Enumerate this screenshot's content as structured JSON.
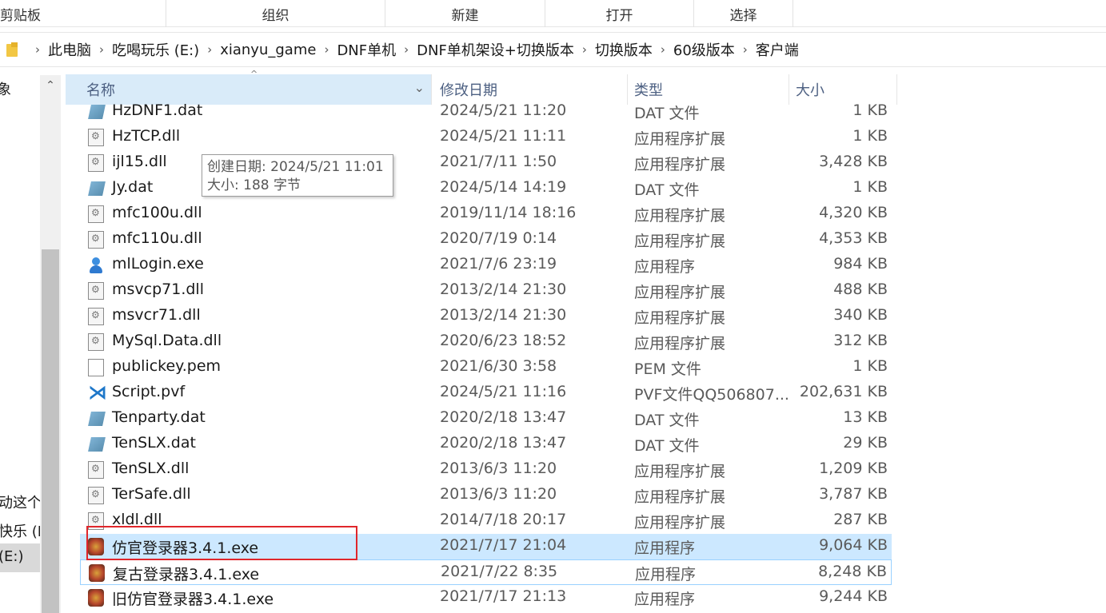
{
  "ribbon": {
    "groups": [
      "剪贴板",
      "组织",
      "新建",
      "打开",
      "选择"
    ]
  },
  "address_bar": {
    "crumbs": [
      "此电脑",
      "吃喝玩乐 (E:)",
      "xianyu_game",
      "DNF单机",
      "DNF单机架设+切换版本",
      "切换版本",
      "60级版本",
      "客户端"
    ],
    "separator": "›"
  },
  "nav_pane": {
    "items": [
      "象",
      "动这个",
      "快乐 (D",
      "(E:)"
    ],
    "scroll_up": "⌃"
  },
  "columns": {
    "name": "名称",
    "date": "修改日期",
    "type": "类型",
    "size": "大小",
    "sort_indicator": "^",
    "dropdown": "⌄"
  },
  "files": [
    {
      "name": "HzDNF1.dat",
      "date": "2024/5/21 11:20",
      "type": "DAT 文件",
      "size": "1 KB",
      "icon": "dat-file-icon"
    },
    {
      "name": "HzTCP.dll",
      "date": "2024/5/21 11:11",
      "type": "应用程序扩展",
      "size": "1 KB",
      "icon": "dll-file-icon"
    },
    {
      "name": "ijl15.dll",
      "date": "2021/7/11 1:50",
      "type": "应用程序扩展",
      "size": "3,428 KB",
      "icon": "dll-file-icon"
    },
    {
      "name": "Jy.dat",
      "date": "2024/5/14 14:19",
      "type": "DAT 文件",
      "size": "1 KB",
      "icon": "dat-file-icon"
    },
    {
      "name": "mfc100u.dll",
      "date": "2019/11/14 18:16",
      "type": "应用程序扩展",
      "size": "4,320 KB",
      "icon": "dll-file-icon"
    },
    {
      "name": "mfc110u.dll",
      "date": "2020/7/19 0:14",
      "type": "应用程序扩展",
      "size": "4,353 KB",
      "icon": "dll-file-icon"
    },
    {
      "name": "mlLogin.exe",
      "date": "2021/7/6 23:19",
      "type": "应用程序",
      "size": "984 KB",
      "icon": "user-exe-icon"
    },
    {
      "name": "msvcp71.dll",
      "date": "2013/2/14 21:30",
      "type": "应用程序扩展",
      "size": "488 KB",
      "icon": "dll-file-icon"
    },
    {
      "name": "msvcr71.dll",
      "date": "2013/2/14 21:30",
      "type": "应用程序扩展",
      "size": "340 KB",
      "icon": "dll-file-icon"
    },
    {
      "name": "MySql.Data.dll",
      "date": "2020/6/23 18:52",
      "type": "应用程序扩展",
      "size": "312 KB",
      "icon": "dll-file-icon"
    },
    {
      "name": "publickey.pem",
      "date": "2021/6/30 3:58",
      "type": "PEM 文件",
      "size": "1 KB",
      "icon": "pem-file-icon"
    },
    {
      "name": "Script.pvf",
      "date": "2024/5/21 11:16",
      "type": "PVF文件QQ506807...",
      "size": "202,631 KB",
      "icon": "vscode-file-icon"
    },
    {
      "name": "Tenparty.dat",
      "date": "2020/2/18 13:47",
      "type": "DAT 文件",
      "size": "13 KB",
      "icon": "dat-file-icon"
    },
    {
      "name": "TenSLX.dat",
      "date": "2020/2/18 13:47",
      "type": "DAT 文件",
      "size": "29 KB",
      "icon": "dat-file-icon"
    },
    {
      "name": "TenSLX.dll",
      "date": "2013/6/3 11:20",
      "type": "应用程序扩展",
      "size": "1,209 KB",
      "icon": "dll-file-icon"
    },
    {
      "name": "TerSafe.dll",
      "date": "2013/6/3 11:20",
      "type": "应用程序扩展",
      "size": "3,787 KB",
      "icon": "dll-file-icon"
    },
    {
      "name": "xldl.dll",
      "date": "2014/7/18 20:17",
      "type": "应用程序扩展",
      "size": "287 KB",
      "icon": "dll-file-icon"
    },
    {
      "name": "仿官登录器3.4.1.exe",
      "date": "2021/7/17 21:04",
      "type": "应用程序",
      "size": "9,064 KB",
      "icon": "game-exe-icon",
      "selected": true
    },
    {
      "name": "复古登录器3.4.1.exe",
      "date": "2021/7/22 8:35",
      "type": "应用程序",
      "size": "8,248 KB",
      "icon": "game-exe-icon",
      "hover": true
    },
    {
      "name": "旧仿官登录器3.4.1.exe",
      "date": "2021/7/17 21:13",
      "type": "应用程序",
      "size": "9,244 KB",
      "icon": "game-exe-icon"
    }
  ],
  "tooltip": {
    "line1": "创建日期: 2024/5/21 11:01",
    "line2": "大小: 188 字节"
  },
  "colors": {
    "selected_row": "#cce8ff",
    "hover_border": "#99d1ff",
    "highlight_box": "#e0262b",
    "column_header_text": "#4d6082"
  }
}
